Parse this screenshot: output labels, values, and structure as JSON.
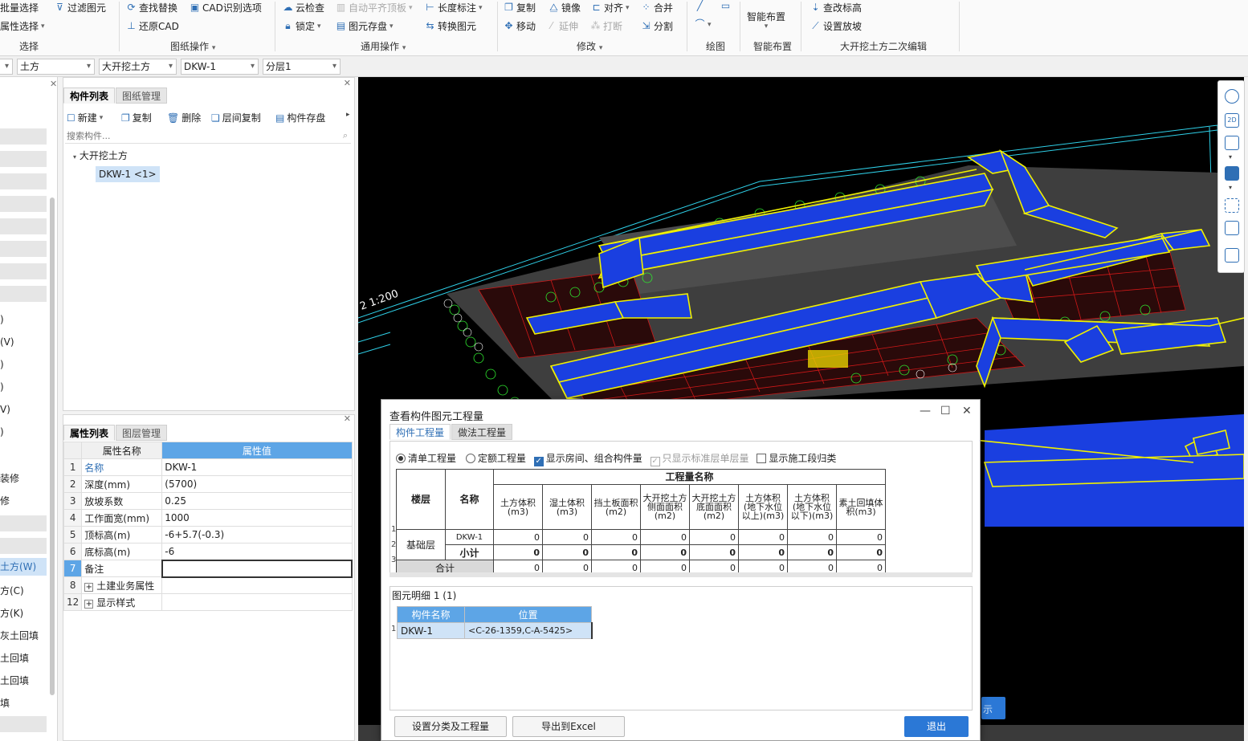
{
  "ribbon": {
    "select_group": {
      "items": [
        "批量选择",
        "属性选择"
      ],
      "label": "选择"
    },
    "filter_item": "过滤图元",
    "drawing_ops": {
      "items": [
        "查找替换",
        "CAD识别选项",
        "还原CAD"
      ],
      "label": "图纸操作"
    },
    "common_ops": {
      "items": [
        "云检查",
        "自动平齐顶板",
        "锁定",
        "图元存盘",
        "长度标注",
        "转换图元"
      ],
      "label": "通用操作"
    },
    "modify": {
      "items": [
        "复制",
        "镜像",
        "对齐",
        "合并",
        "移动",
        "延伸",
        "打断",
        "分割"
      ],
      "label": "修改"
    },
    "draw_label": "绘图",
    "smart": {
      "item": "智能布置",
      "label": "智能布置"
    },
    "secondary": {
      "items": [
        "查改标高",
        "设置放坡"
      ],
      "label": "大开挖土方二次编辑"
    }
  },
  "selectors": [
    "土方",
    "大开挖土方",
    "DKW-1",
    "分层1"
  ],
  "nav_left": {
    "items": [
      ")",
      "(V)",
      ")",
      ")",
      "V)",
      ")",
      "装修",
      "修",
      "土方(W)",
      "方(C)",
      "方(K)",
      "灰土回填",
      "土回填",
      "土回填",
      "填"
    ],
    "active_index": 8
  },
  "component_list": {
    "tabs": [
      "构件列表",
      "图纸管理"
    ],
    "toolbar": [
      "新建",
      "复制",
      "删除",
      "层间复制",
      "构件存盘"
    ],
    "search_placeholder": "搜索构件...",
    "tree_root": "大开挖土方",
    "tree_child": "DKW-1 <1>"
  },
  "properties": {
    "tabs": [
      "属性列表",
      "图层管理"
    ],
    "headers": [
      "属性名称",
      "属性值"
    ],
    "rows": [
      {
        "no": "1",
        "name": "名称",
        "value": "DKW-1"
      },
      {
        "no": "2",
        "name": "深度(mm)",
        "value": "(5700)"
      },
      {
        "no": "3",
        "name": "放坡系数",
        "value": "0.25"
      },
      {
        "no": "4",
        "name": "工作面宽(mm)",
        "value": "1000"
      },
      {
        "no": "5",
        "name": "顶标高(m)",
        "value": "-6+5.7(-0.3)"
      },
      {
        "no": "6",
        "name": "底标高(m)",
        "value": "-6"
      },
      {
        "no": "7",
        "name": "备注",
        "value": ""
      },
      {
        "no": "8",
        "name": "土建业务属性",
        "value": ""
      },
      {
        "no": "12",
        "name": "显示样式",
        "value": ""
      }
    ]
  },
  "viewport": {
    "scale_label": "2 1:200",
    "hidden_button_text": "示"
  },
  "dialog": {
    "title": "查看构件图元工程量",
    "tabs": [
      "构件工程量",
      "做法工程量"
    ],
    "options": {
      "radio1": "清单工程量",
      "radio2": "定额工程量",
      "chk1": "显示房间、组合构件量",
      "chk2": "只显示标准层单层量",
      "chk3": "显示施工段归类"
    },
    "table": {
      "group_header": "工程量名称",
      "floor_header": "楼层",
      "name_header": "名称",
      "columns": [
        "土方体积(m3)",
        "湿土体积(m3)",
        "挡土板面积(m2)",
        "大开挖土方侧面面积(m2)",
        "大开挖土方底面面积(m2)",
        "土方体积(地下水位以上)(m3)",
        "土方体积(地下水位以下)(m3)",
        "素土回填体积(m3)"
      ],
      "floor": "基础层",
      "rows": [
        {
          "no": "1",
          "name": "DKW-1",
          "values": [
            "0",
            "0",
            "0",
            "0",
            "0",
            "0",
            "0",
            "0"
          ]
        },
        {
          "no": "2",
          "name": "小计",
          "values": [
            "0",
            "0",
            "0",
            "0",
            "0",
            "0",
            "0",
            "0"
          ]
        },
        {
          "no": "3",
          "name": "合计",
          "values": [
            "0",
            "0",
            "0",
            "0",
            "0",
            "0",
            "0",
            "0"
          ]
        }
      ]
    },
    "detail": {
      "title": "图元明细",
      "count": "1 (1)",
      "headers": [
        "构件名称",
        "位置"
      ],
      "row": {
        "no": "1",
        "name": "DKW-1",
        "pos": "<C-26-1359,C-A-5425>"
      }
    },
    "buttons": {
      "classify": "设置分类及工程量",
      "export": "导出到Excel",
      "exit": "退出"
    }
  },
  "colors": {
    "accent": "#2f6fb5",
    "selected": "#cfe3f7",
    "header_blue": "#5da5e6",
    "exit_btn": "#2b78d6",
    "excavation_blue": "#1a3fe0",
    "outline_yellow": "#f0f000"
  }
}
